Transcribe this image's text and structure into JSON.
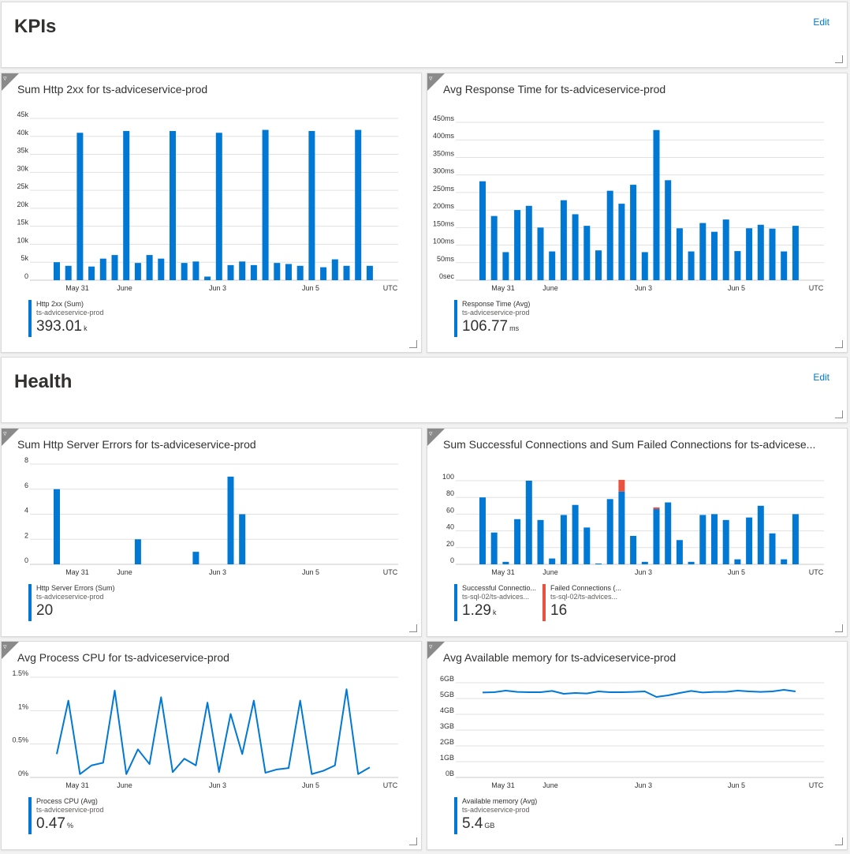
{
  "sections": {
    "kpis": {
      "title": "KPIs",
      "edit_label": "Edit"
    },
    "health": {
      "title": "Health",
      "edit_label": "Edit"
    }
  },
  "colors": {
    "accent": "#0078d4",
    "failed": "#e8533f",
    "grid": "#e1e1e1",
    "text": "#323130"
  },
  "icons": {
    "filter": "filter-icon",
    "resize": "resize-handle-icon"
  },
  "tiles": {
    "http2xx": {
      "title": "Sum Http 2xx for ts-adviceservice-prod",
      "legend": [
        {
          "name": "Http 2xx (Sum)",
          "resource": "ts-adviceservice-prod",
          "value": "393.01",
          "unit": "k",
          "color": "#0078d4"
        }
      ]
    },
    "resp": {
      "title": "Avg Response Time for ts-adviceservice-prod",
      "legend": [
        {
          "name": "Response Time (Avg)",
          "resource": "ts-adviceservice-prod",
          "value": "106.77",
          "unit": "ms",
          "color": "#0078d4"
        }
      ]
    },
    "errors": {
      "title": "Sum Http Server Errors for ts-adviceservice-prod",
      "legend": [
        {
          "name": "Http Server Errors (Sum)",
          "resource": "ts-adviceservice-prod",
          "value": "20",
          "unit": "",
          "color": "#0078d4"
        }
      ]
    },
    "conn": {
      "title": "Sum Successful Connections and Sum Failed Connections for ts-advicese...",
      "legend": [
        {
          "name": "Successful Connectio...",
          "resource": "ts-sql-02/ts-advices...",
          "value": "1.29",
          "unit": "k",
          "color": "#0078d4"
        },
        {
          "name": "Failed Connections (...",
          "resource": "ts-sql-02/ts-advices...",
          "value": "16",
          "unit": "",
          "color": "#e8533f"
        }
      ]
    },
    "cpu": {
      "title": "Avg Process CPU for ts-adviceservice-prod",
      "legend": [
        {
          "name": "Process CPU (Avg)",
          "resource": "ts-adviceservice-prod",
          "value": "0.47",
          "unit": "%",
          "color": "#0078d4"
        }
      ]
    },
    "mem": {
      "title": "Avg Available memory for ts-adviceservice-prod",
      "legend": [
        {
          "name": "Available memory (Avg)",
          "resource": "ts-adviceservice-prod",
          "value": "5.4",
          "unit": "GB",
          "color": "#0078d4"
        }
      ]
    }
  },
  "chart_data": [
    {
      "id": "http2xx",
      "type": "bar",
      "x_ticks": [
        "May 31",
        "June",
        "Jun 3",
        "Jun 5",
        "UTC"
      ],
      "y_ticks": [
        "0",
        "5k",
        "10k",
        "15k",
        "20k",
        "25k",
        "30k",
        "35k",
        "40k",
        "45k"
      ],
      "ylim": [
        0,
        45000
      ],
      "grid": true,
      "series": [
        {
          "name": "Http 2xx (Sum)",
          "color": "#0078d4",
          "values": [
            5000,
            4000,
            41000,
            3800,
            6000,
            7000,
            41500,
            4800,
            7000,
            6000,
            41500,
            4800,
            5200,
            1000,
            41000,
            4200,
            5200,
            4200,
            41800,
            4800,
            4500,
            4000,
            41500,
            3600,
            5800,
            4000,
            41800,
            4000
          ]
        }
      ]
    },
    {
      "id": "resp",
      "type": "bar",
      "x_ticks": [
        "May 31",
        "June",
        "Jun 3",
        "Jun 5",
        "UTC"
      ],
      "y_ticks": [
        "0sec",
        "50ms",
        "100ms",
        "150ms",
        "200ms",
        "250ms",
        "300ms",
        "350ms",
        "400ms",
        "450ms"
      ],
      "ylim": [
        0,
        450
      ],
      "grid": true,
      "series": [
        {
          "name": "Response Time (Avg)",
          "color": "#0078d4",
          "values": [
            282,
            183,
            80,
            200,
            212,
            150,
            82,
            228,
            188,
            155,
            85,
            255,
            218,
            272,
            80,
            428,
            285,
            148,
            82,
            163,
            138,
            173,
            83,
            148,
            158,
            147,
            82,
            155
          ]
        }
      ]
    },
    {
      "id": "errors",
      "type": "bar",
      "x_ticks": [
        "May 31",
        "June",
        "Jun 3",
        "Jun 5",
        "UTC"
      ],
      "y_ticks": [
        "0",
        "2",
        "4",
        "6",
        "8"
      ],
      "ylim": [
        0,
        8
      ],
      "grid": true,
      "series": [
        {
          "name": "Http Server Errors (Sum)",
          "color": "#0078d4",
          "values": [
            6,
            0,
            0,
            0,
            0,
            0,
            0,
            2,
            0,
            0,
            0,
            0,
            1,
            0,
            0,
            7,
            4,
            0,
            0,
            0,
            0,
            0,
            0,
            0,
            0,
            0,
            0,
            0
          ]
        }
      ]
    },
    {
      "id": "conn",
      "type": "stacked-bar",
      "x_ticks": [
        "May 31",
        "June",
        "Jun 3",
        "Jun 5",
        "UTC"
      ],
      "y_ticks": [
        "0",
        "20",
        "40",
        "60",
        "80",
        "100"
      ],
      "ylim": [
        0,
        100
      ],
      "grid": true,
      "series": [
        {
          "name": "Successful Connections",
          "color": "#0078d4",
          "values": [
            80,
            38,
            3,
            54,
            100,
            53,
            7,
            59,
            71,
            44,
            1,
            78,
            87,
            34,
            3,
            66,
            74,
            29,
            3,
            59,
            60,
            53,
            6,
            56,
            70,
            37,
            6,
            60
          ]
        },
        {
          "name": "Failed Connections",
          "color": "#e8533f",
          "values": [
            0,
            0,
            0,
            0,
            0,
            0,
            0,
            0,
            0,
            0,
            0,
            0,
            14,
            0,
            0,
            2,
            0,
            0,
            0,
            0,
            0,
            0,
            0,
            0,
            0,
            0,
            0,
            0
          ]
        }
      ]
    },
    {
      "id": "cpu",
      "type": "line",
      "x_ticks": [
        "May 31",
        "June",
        "Jun 3",
        "Jun 5",
        "UTC"
      ],
      "y_ticks": [
        "0%",
        "0.5%",
        "1%",
        "1.5%"
      ],
      "ylim": [
        0,
        1.5
      ],
      "grid": true,
      "series": [
        {
          "name": "Process CPU (Avg)",
          "color": "#0078d4",
          "values": [
            0.35,
            1.15,
            0.05,
            0.18,
            0.22,
            1.3,
            0.05,
            0.42,
            0.2,
            1.2,
            0.08,
            0.28,
            0.18,
            1.12,
            0.08,
            0.95,
            0.35,
            1.15,
            0.07,
            0.12,
            0.14,
            1.15,
            0.05,
            0.1,
            0.18,
            1.32,
            0.05,
            0.15
          ]
        }
      ]
    },
    {
      "id": "mem",
      "type": "line",
      "x_ticks": [
        "May 31",
        "June",
        "Jun 3",
        "Jun 5",
        "UTC"
      ],
      "y_ticks": [
        "0B",
        "1GB",
        "2GB",
        "3GB",
        "4GB",
        "5GB",
        "6GB"
      ],
      "ylim": [
        0,
        6
      ],
      "grid": true,
      "series": [
        {
          "name": "Available memory (Avg)",
          "color": "#0078d4",
          "values": [
            5.38,
            5.4,
            5.5,
            5.42,
            5.4,
            5.4,
            5.48,
            5.3,
            5.35,
            5.32,
            5.45,
            5.4,
            5.4,
            5.42,
            5.45,
            5.1,
            5.2,
            5.35,
            5.48,
            5.38,
            5.42,
            5.42,
            5.5,
            5.45,
            5.42,
            5.45,
            5.55,
            5.45
          ]
        }
      ]
    }
  ]
}
